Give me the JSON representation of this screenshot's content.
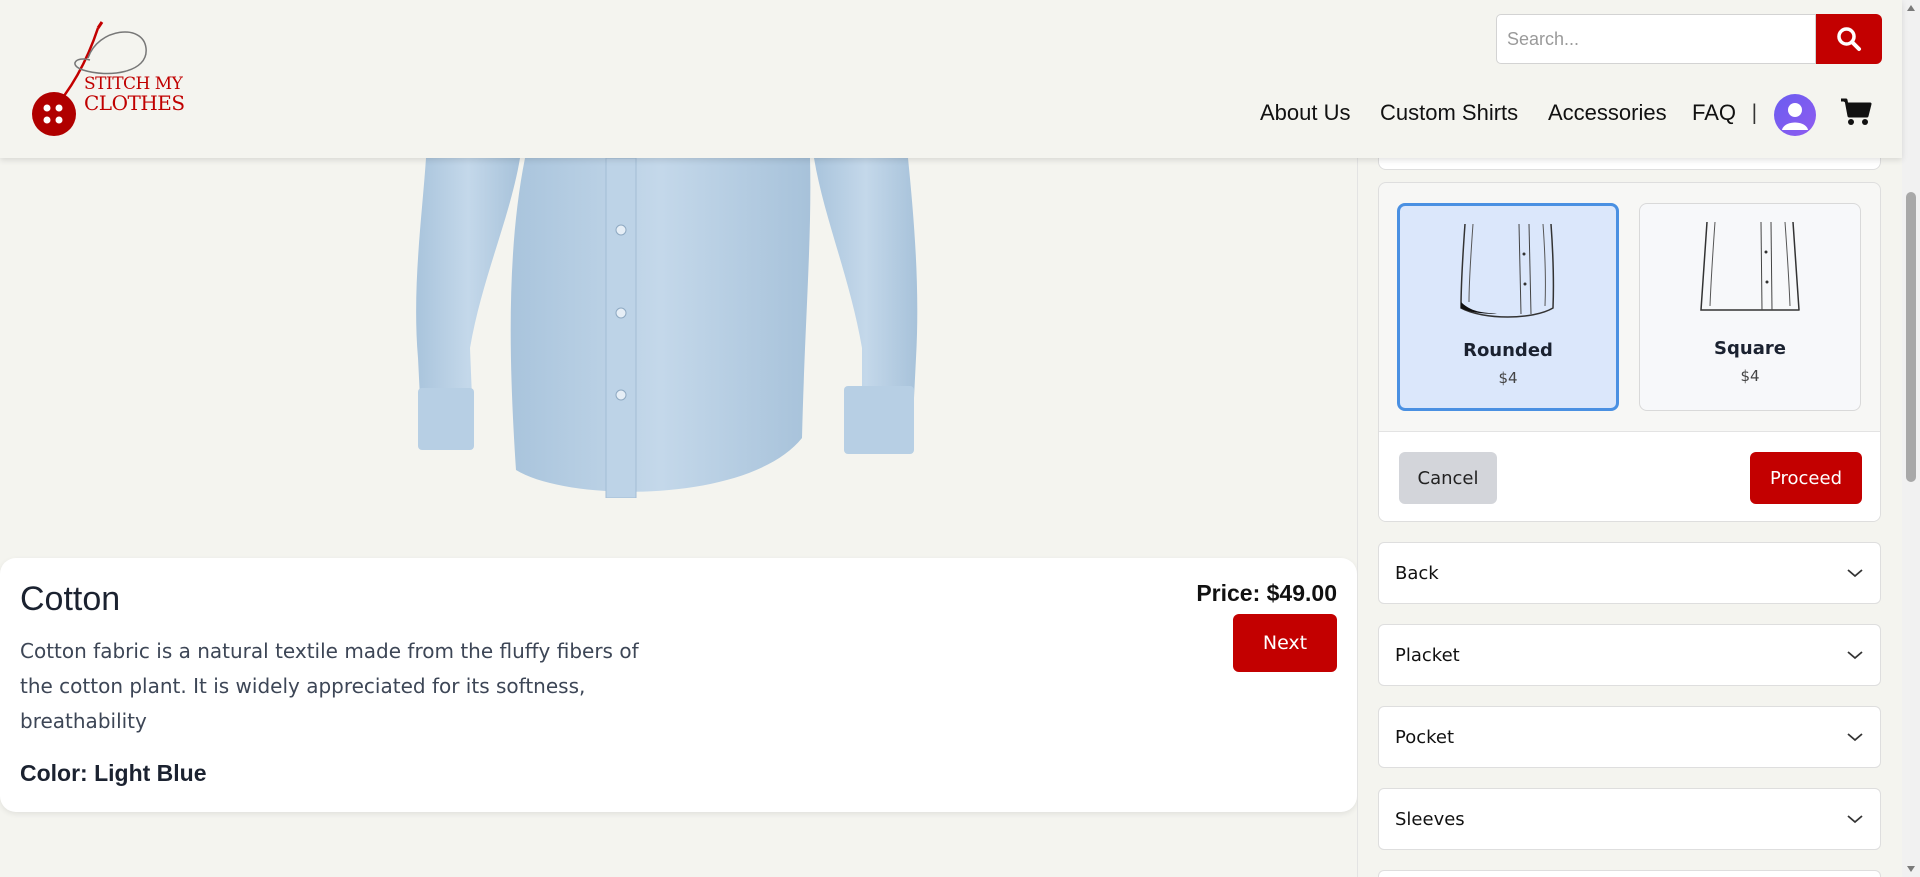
{
  "brand": {
    "logo_line1": "STITCH MY",
    "logo_line2": "CLOTHES",
    "accent_color": "#c30000"
  },
  "search": {
    "placeholder": "Search...",
    "icon": "search-icon"
  },
  "nav": {
    "items": [
      {
        "label": "About Us"
      },
      {
        "label": "Custom Shirts"
      },
      {
        "label": "Accessories"
      },
      {
        "label": "FAQ"
      }
    ],
    "separator": "|",
    "avatar_icon": "user-avatar-icon",
    "cart_icon": "cart-icon"
  },
  "product": {
    "name": "Cotton",
    "description": "Cotton fabric is a natural textile made from the fluffy fibers of the cotton plant. It is widely appreciated for its softness, breathability",
    "color_text": "Color: Light Blue",
    "price_text": "Price: $49.00",
    "next_label": "Next"
  },
  "customizer": {
    "options": [
      {
        "label": "Rounded",
        "price": "$4",
        "selected": true
      },
      {
        "label": "Square",
        "price": "$4",
        "selected": false
      }
    ],
    "cancel_label": "Cancel",
    "proceed_label": "Proceed",
    "sections": [
      {
        "label": "Back"
      },
      {
        "label": "Placket"
      },
      {
        "label": "Pocket"
      },
      {
        "label": "Sleeves"
      }
    ]
  }
}
